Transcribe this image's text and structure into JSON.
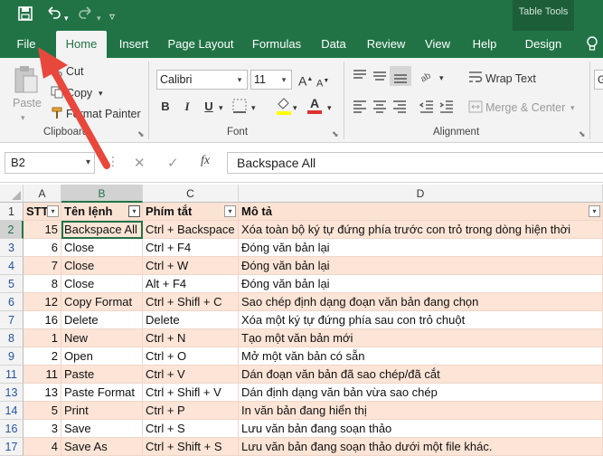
{
  "quick_access": {
    "save_icon": "save-icon",
    "undo_icon": "undo-icon",
    "redo_icon": "redo-icon",
    "customize_icon": "customize-icon"
  },
  "context_tab_group": "Table Tools",
  "tabs": [
    {
      "id": "file",
      "label": "File"
    },
    {
      "id": "home",
      "label": "Home"
    },
    {
      "id": "insert",
      "label": "Insert"
    },
    {
      "id": "page-layout",
      "label": "Page Layout"
    },
    {
      "id": "formulas",
      "label": "Formulas"
    },
    {
      "id": "data",
      "label": "Data"
    },
    {
      "id": "review",
      "label": "Review"
    },
    {
      "id": "view",
      "label": "View"
    },
    {
      "id": "help",
      "label": "Help"
    },
    {
      "id": "design",
      "label": "Design"
    }
  ],
  "ribbon": {
    "clipboard": {
      "paste": "Paste",
      "cut": "Cut",
      "copy": "Copy",
      "format_painter": "Format Painter",
      "label": "Clipboard"
    },
    "font": {
      "name": "Calibri",
      "size": "11",
      "label": "Font",
      "bold": "B",
      "italic": "I",
      "underline": "U",
      "font_color_letter": "A"
    },
    "alignment": {
      "wrap_text": "Wrap Text",
      "merge_center": "Merge & Center",
      "label": "Alignment"
    }
  },
  "formula_bar": {
    "name_box": "B2",
    "fx": "fx",
    "value": "Backspace All"
  },
  "columns": [
    "A",
    "B",
    "C",
    "D"
  ],
  "header_row": {
    "row": "1",
    "stt": "STT",
    "name": "Tên lệnh",
    "shortcut": "Phím tắt",
    "desc": "Mô tả"
  },
  "rows": [
    {
      "row": "2",
      "stt": "15",
      "name": "Backspace All",
      "shortcut": "Ctrl + Backspace",
      "desc": "Xóa toàn bộ ký tự đứng phía trước con trỏ trong dòng hiện thời"
    },
    {
      "row": "3",
      "stt": "6",
      "name": "Close",
      "shortcut": "Ctrl + F4",
      "desc": "Đóng văn bản lại"
    },
    {
      "row": "4",
      "stt": "7",
      "name": "Close",
      "shortcut": "Ctrl + W",
      "desc": "Đóng văn bản lại"
    },
    {
      "row": "5",
      "stt": "8",
      "name": "Close",
      "shortcut": "Alt + F4",
      "desc": "Đóng văn bản lại"
    },
    {
      "row": "6",
      "stt": "12",
      "name": "Copy Format",
      "shortcut": "Ctrl + Shifl + C",
      "desc": "Sao chép định dạng đoạn văn bản đang chọn"
    },
    {
      "row": "7",
      "stt": "16",
      "name": "Delete",
      "shortcut": "Delete",
      "desc": "Xóa một ký tự đứng phía sau con trỏ chuột"
    },
    {
      "row": "8",
      "stt": "1",
      "name": "New",
      "shortcut": "Ctrl + N",
      "desc": "Tạo một văn bản mới"
    },
    {
      "row": "9",
      "stt": "2",
      "name": "Open",
      "shortcut": "Ctrl + O",
      "desc": "Mở một văn bản có sẵn"
    },
    {
      "row": "11",
      "stt": "11",
      "name": "Paste",
      "shortcut": "Ctrl + V",
      "desc": "Dán đoạn văn bản đã sao chép/đã cắt"
    },
    {
      "row": "13",
      "stt": "13",
      "name": "Paste Format",
      "shortcut": "Ctrl + Shifl + V",
      "desc": "Dán định dạng văn bản vừa sao chép"
    },
    {
      "row": "14",
      "stt": "5",
      "name": "Print",
      "shortcut": "Ctrl + P",
      "desc": "In văn bản đang hiển thị"
    },
    {
      "row": "16",
      "stt": "3",
      "name": "Save",
      "shortcut": "Ctrl + S",
      "desc": "Lưu văn bản đang soạn thảo"
    },
    {
      "row": "17",
      "stt": "4",
      "name": "Save As",
      "shortcut": "Ctrl + Shift + S",
      "desc": "Lưu văn bản đang soạn thảo dưới một file khác."
    }
  ],
  "colors": {
    "excel_green": "#217346",
    "band": "#fce4d6",
    "arrow": "#e8473c"
  }
}
